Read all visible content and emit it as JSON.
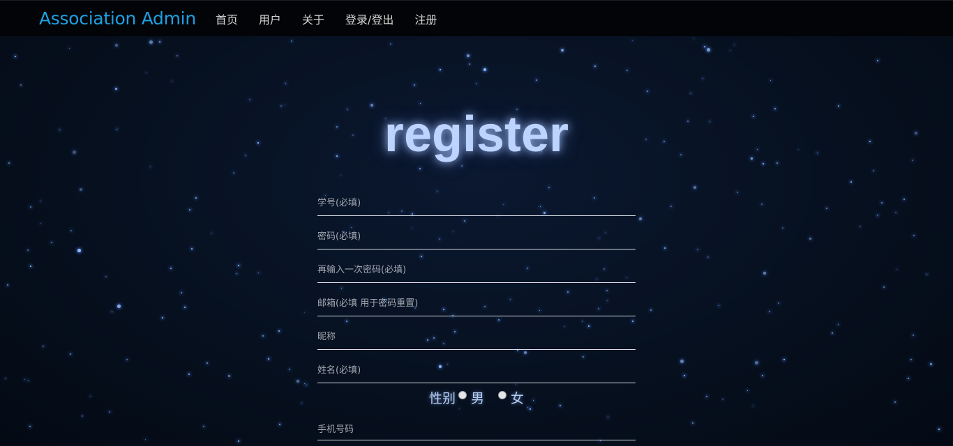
{
  "navbar": {
    "brand": "Association Admin",
    "items": [
      {
        "label": "首页"
      },
      {
        "label": "用户"
      },
      {
        "label": "关于"
      },
      {
        "label": "登录/登出"
      },
      {
        "label": "注册"
      }
    ]
  },
  "page_title": "register",
  "form": {
    "student_id_placeholder": "学号(必填)",
    "password_placeholder": "密码(必填)",
    "confirm_password_placeholder": "再输入一次密码(必填)",
    "email_placeholder": "邮箱(必填 用于密码重置)",
    "nickname_placeholder": "昵称",
    "name_placeholder": "姓名(必填)",
    "gender_label": "性别",
    "gender_male": "男",
    "gender_female": "女",
    "phone_placeholder": "手机号码"
  },
  "colors": {
    "brand": "#1f9fe2",
    "title_glow": "#bcd4ff",
    "background": "#050c18"
  }
}
